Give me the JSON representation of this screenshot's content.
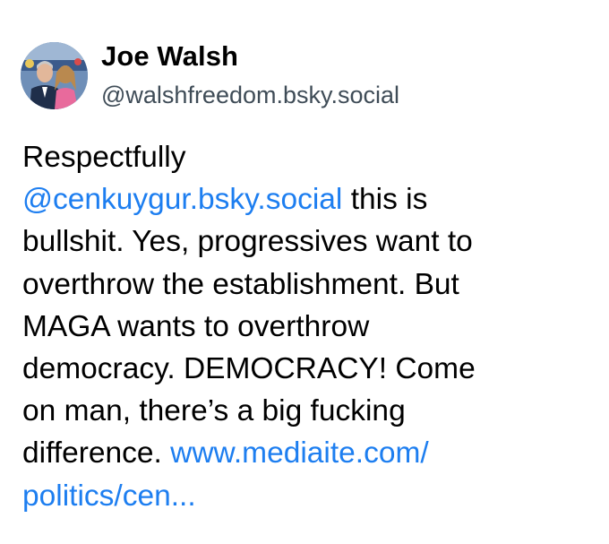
{
  "author": {
    "display_name": "Joe Walsh",
    "handle": "@walshfreedom.bsky.social"
  },
  "post": {
    "line1": "Respectfully",
    "mention": "@cenkuygur.bsky.social",
    "line2_rest": " this is",
    "line3": "bullshit. Yes, progressives want to",
    "line4": "overthrow the establishment. But",
    "line5": "MAGA wants to overthrow",
    "line6": "democracy. DEMOCRACY! Come",
    "line7": "on man, there’s a big fucking",
    "line8_prefix": "difference. ",
    "link_part1": "www.mediaite.com/",
    "link_part2": "politics/cen..."
  },
  "colors": {
    "link": "#1d7ef0",
    "handle": "#3f4c57",
    "text": "#000000"
  },
  "icons": {
    "avatar": "profile-photo"
  }
}
